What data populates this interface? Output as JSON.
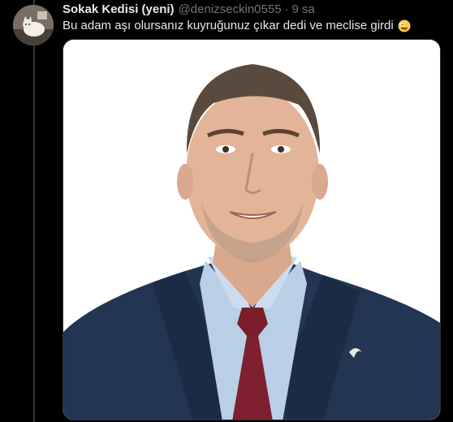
{
  "tweet": {
    "display_name": "Sokak Kedisi (yeni)",
    "handle": "@denizseckin0555",
    "separator": "·",
    "time": "9 sa",
    "text": "Bu adam aşı olursanız kuyruğunuz çıkar dedi ve meclise girdi",
    "emoji": "zany-face-emoji",
    "media": {
      "kind": "photo",
      "subject": "portrait-photo"
    }
  },
  "colors": {
    "background": "#000000",
    "primary_text": "#e7e9ea",
    "secondary_text": "#71767b",
    "thread_line": "#333639"
  }
}
